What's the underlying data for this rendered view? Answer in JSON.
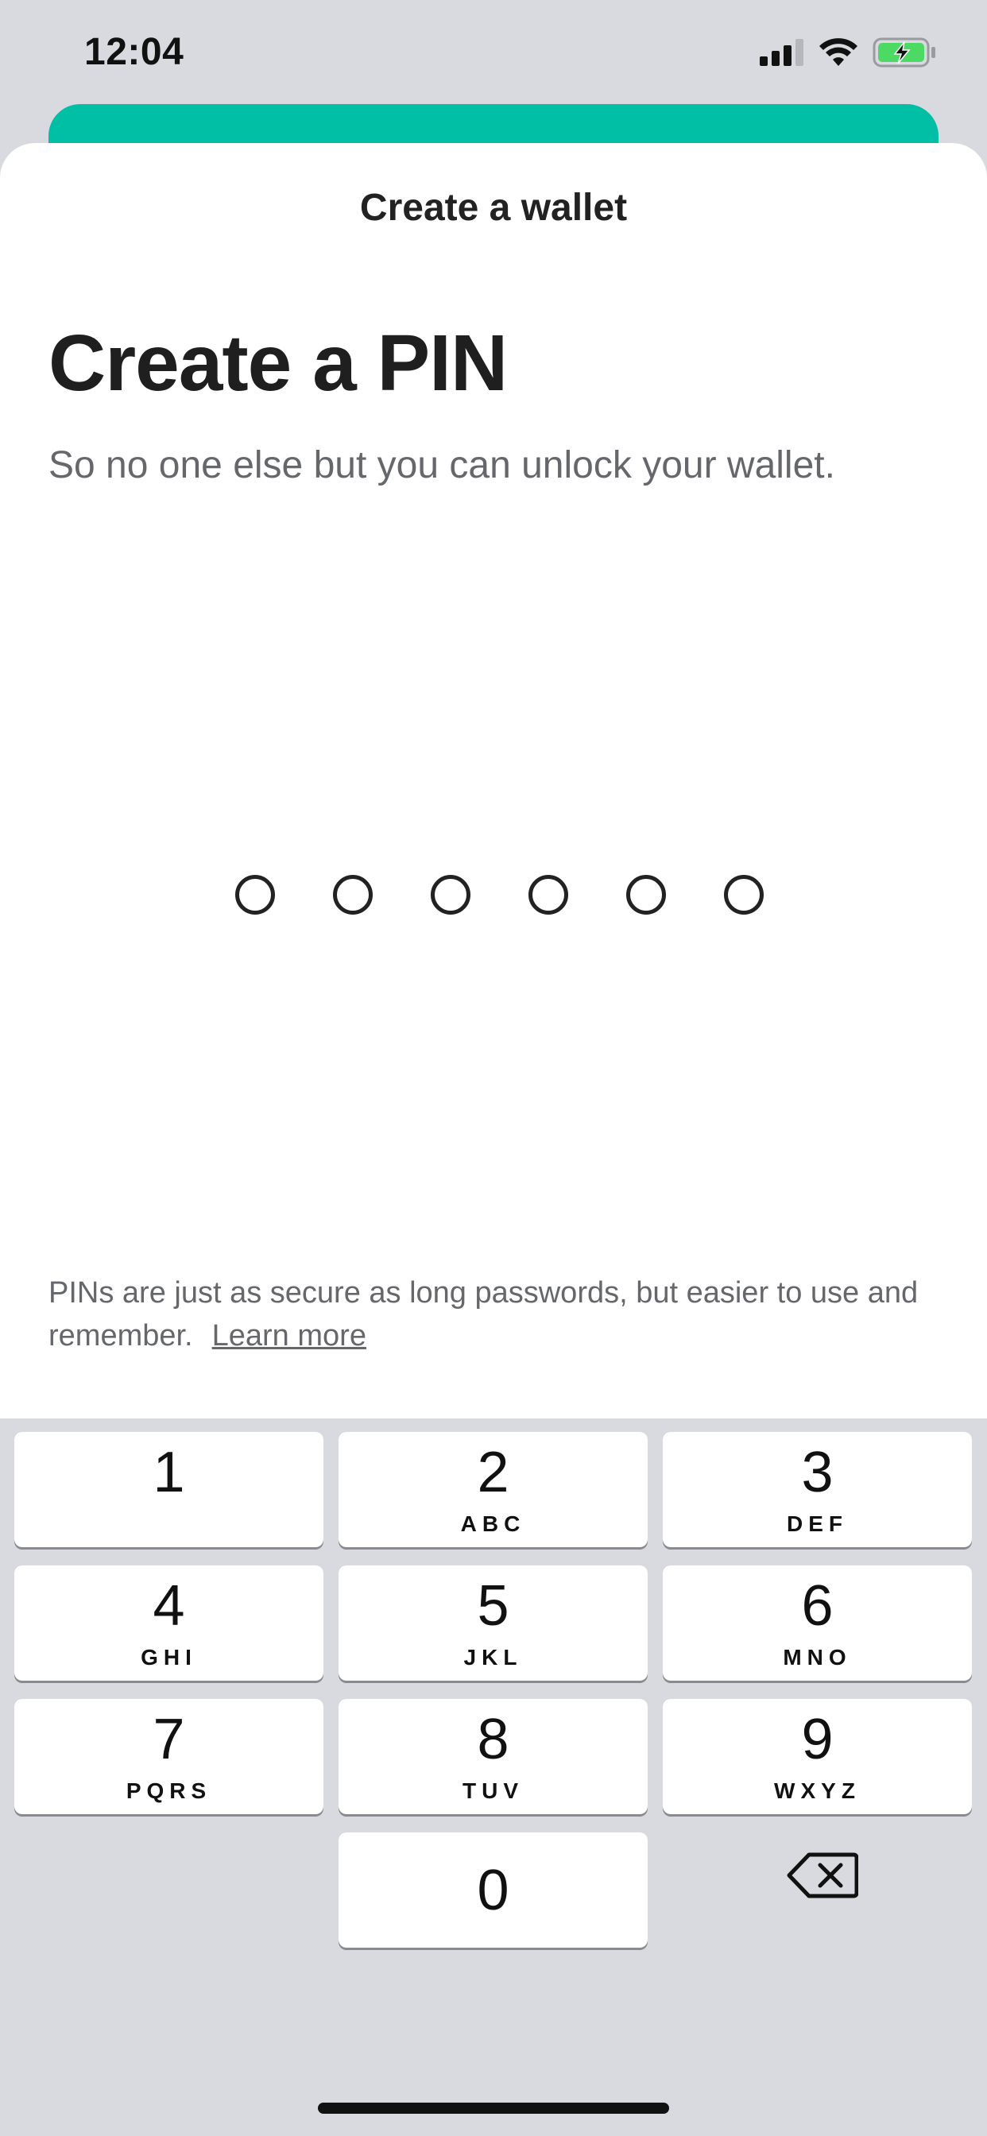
{
  "status_bar": {
    "time": "12:04",
    "icons": [
      "cellular-signal-icon",
      "wifi-icon",
      "battery-charging-icon"
    ]
  },
  "modal": {
    "title": "Create a wallet",
    "heading": "Create a PIN",
    "subheading": "So no one else but you can unlock your wallet.",
    "pin_length": 6,
    "info_text": "PINs are just as secure as long passwords, but easier to use and remember.",
    "learn_more": "Learn more"
  },
  "keypad": {
    "keys": [
      {
        "digit": "1",
        "letters": ""
      },
      {
        "digit": "2",
        "letters": "ABC"
      },
      {
        "digit": "3",
        "letters": "DEF"
      },
      {
        "digit": "4",
        "letters": "GHI"
      },
      {
        "digit": "5",
        "letters": "JKL"
      },
      {
        "digit": "6",
        "letters": "MNO"
      },
      {
        "digit": "7",
        "letters": "PQRS"
      },
      {
        "digit": "8",
        "letters": "TUV"
      },
      {
        "digit": "9",
        "letters": "WXYZ"
      },
      {
        "digit": "0",
        "letters": ""
      }
    ],
    "backspace_icon": "backspace-icon"
  },
  "colors": {
    "accent": "#00bfa5",
    "keypad_bg": "#d8dadf",
    "text_primary": "#1f1f1f",
    "text_secondary": "#66676b"
  }
}
